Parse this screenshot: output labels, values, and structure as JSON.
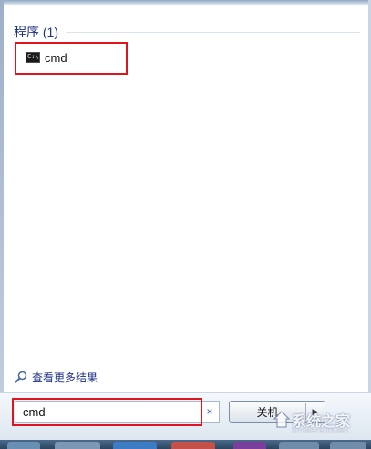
{
  "programs_group": {
    "title": "程序 (1)",
    "items": [
      {
        "label": "cmd",
        "icon": "cmd-console-icon"
      }
    ]
  },
  "see_more": {
    "label": "查看更多结果",
    "icon": "magnifier-icon"
  },
  "search": {
    "value": "cmd",
    "clear_symbol": "×"
  },
  "shutdown": {
    "label": "关机",
    "arrow": "▶"
  },
  "watermark": {
    "text": "系统之家",
    "subtext": "XITONGZHIJIA.NET"
  },
  "colors": {
    "highlight": "#e0141e",
    "link": "#1e3287",
    "panel": "#ffffff"
  }
}
